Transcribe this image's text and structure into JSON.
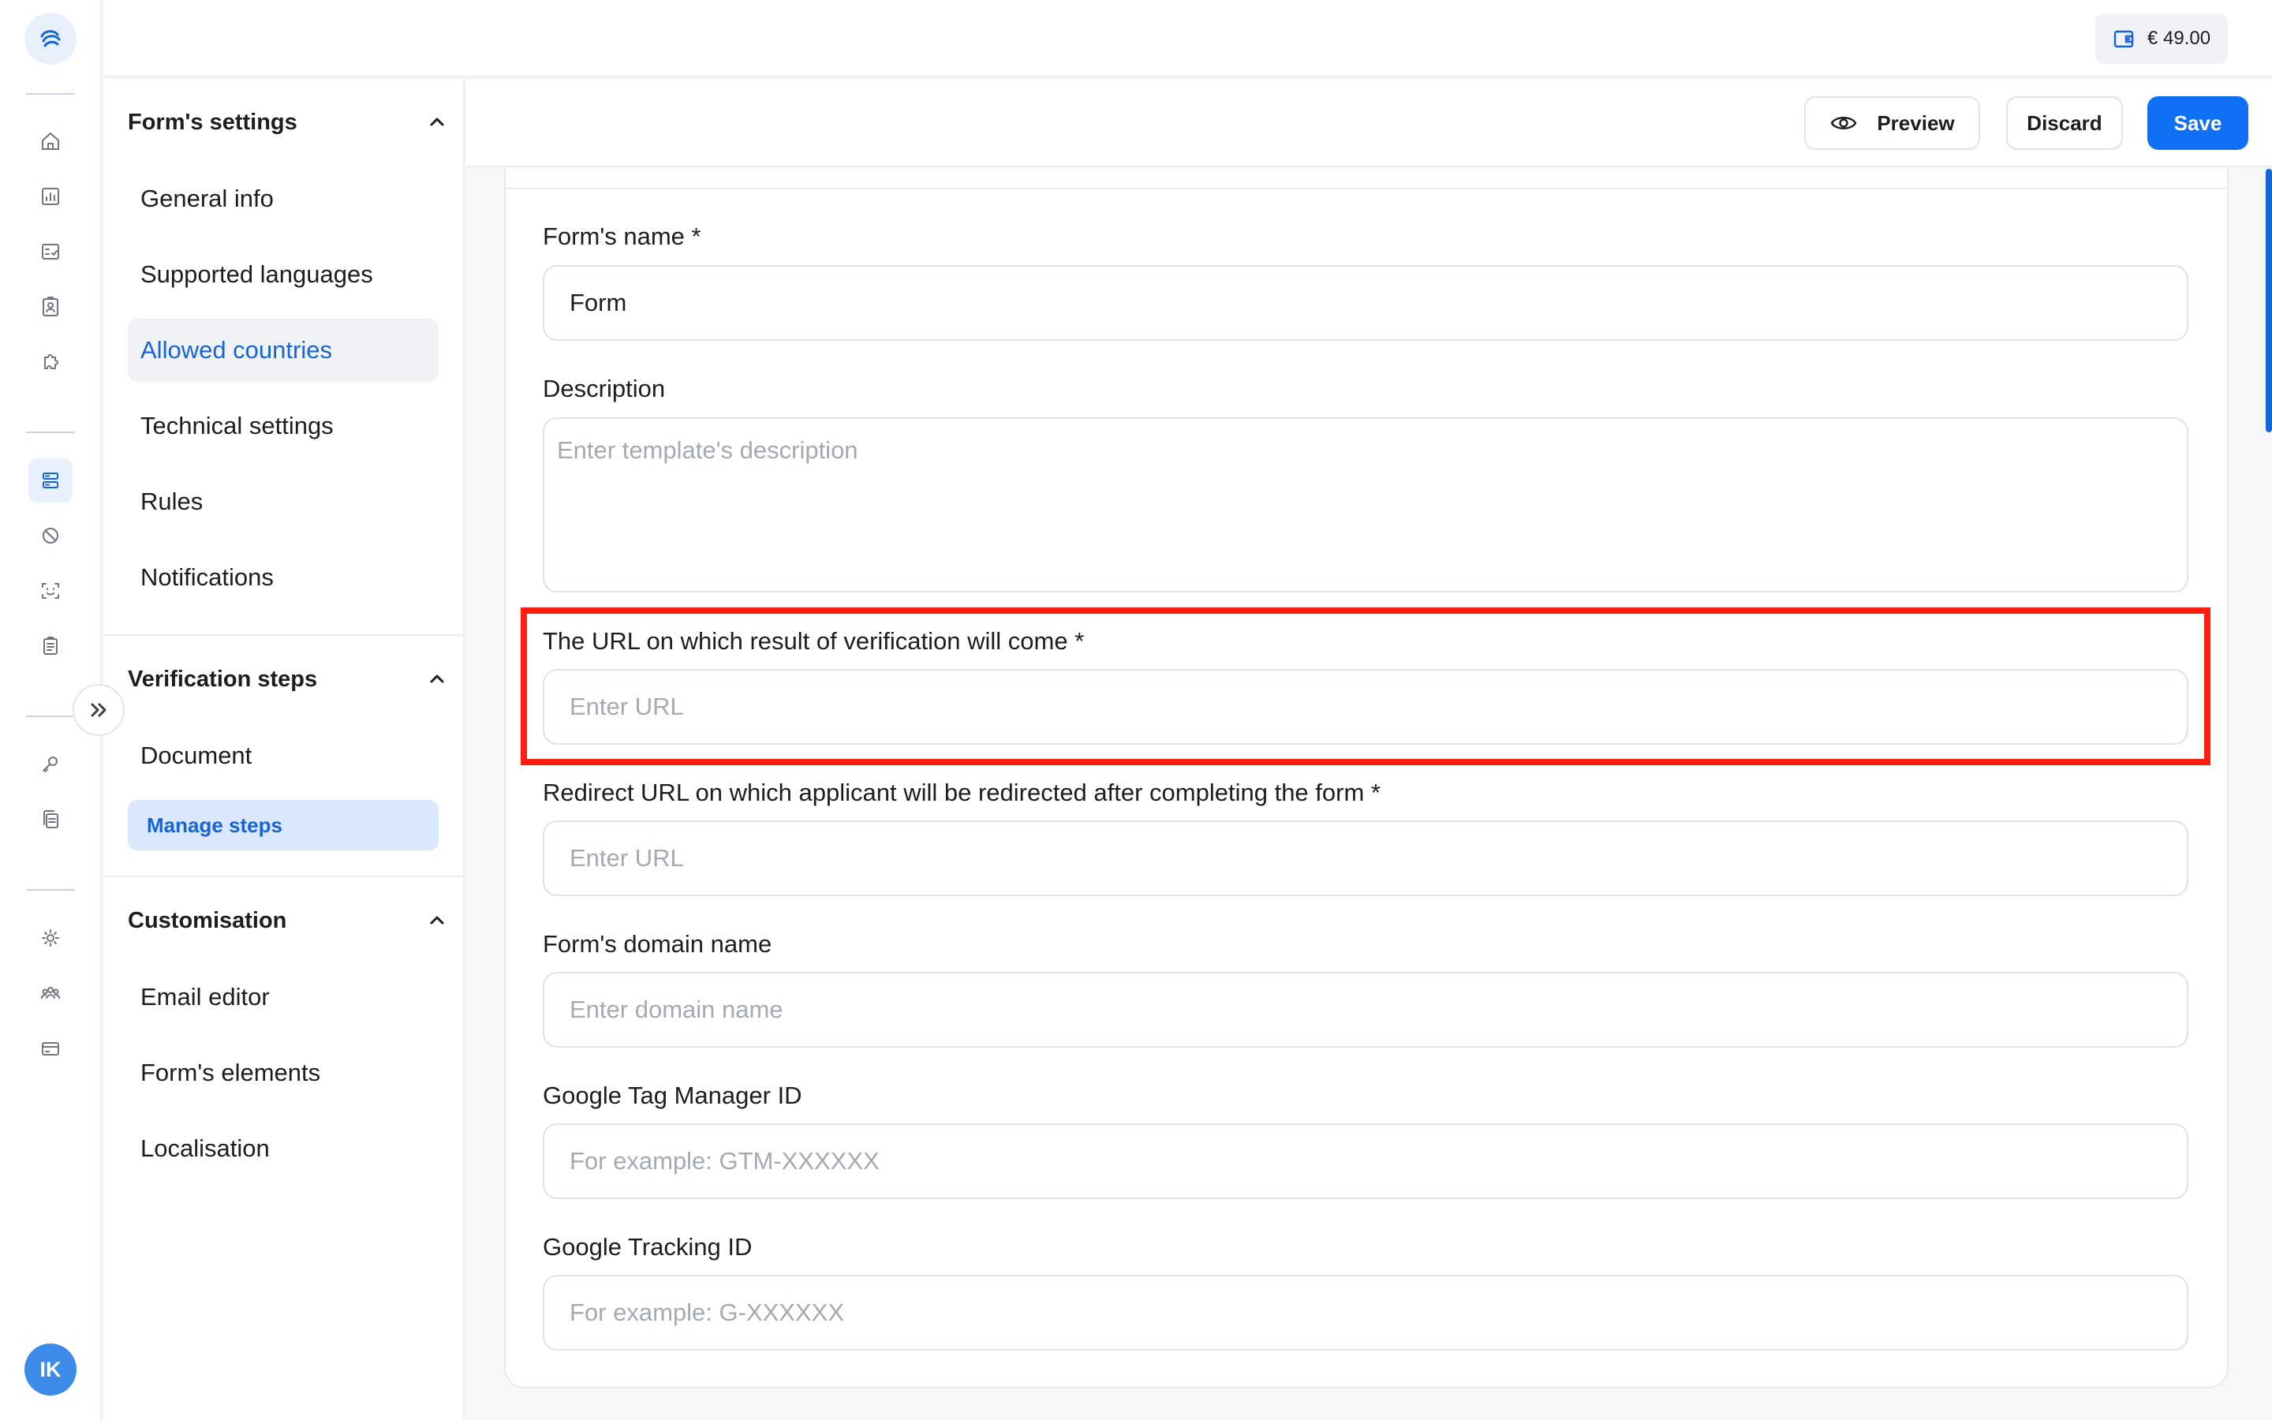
{
  "rail": {
    "logo_icon": "brand-logo-icon",
    "avatar_initials": "IK",
    "items": [
      {
        "icon": "home-icon"
      },
      {
        "icon": "analytics-icon"
      },
      {
        "icon": "checklist-icon"
      },
      {
        "icon": "contact-card-icon"
      },
      {
        "icon": "puzzle-icon"
      },
      {
        "icon": "forms-icon",
        "active": true
      },
      {
        "icon": "blocked-icon"
      },
      {
        "icon": "face-scan-icon"
      },
      {
        "icon": "clipboard-icon"
      },
      {
        "icon": "key-icon"
      },
      {
        "icon": "documents-icon"
      },
      {
        "icon": "settings-icon"
      },
      {
        "icon": "team-icon"
      },
      {
        "icon": "billing-card-icon"
      }
    ]
  },
  "topbar": {
    "balance": "€ 49.00",
    "balance_icon": "wallet-icon"
  },
  "nav": {
    "sections": [
      {
        "title": "Form's settings",
        "items": [
          "General info",
          "Supported languages",
          "Allowed countries",
          "Technical settings",
          "Rules",
          "Notifications"
        ],
        "active_item": "Allowed countries"
      },
      {
        "title": "Verification steps",
        "items": [
          "Document",
          "Manage steps"
        ]
      },
      {
        "title": "Customisation",
        "items": [
          "Email editor",
          "Form's elements",
          "Localisation"
        ]
      }
    ]
  },
  "actions": {
    "preview": "Preview",
    "discard": "Discard",
    "save": "Save"
  },
  "form": {
    "name": {
      "label": "Form's name *",
      "value": "Form"
    },
    "description": {
      "label": "Description",
      "placeholder": "Enter template's description"
    },
    "result_url": {
      "label": "The URL on which result of verification will come *",
      "placeholder": "Enter URL"
    },
    "redirect_url": {
      "label": "Redirect URL on which applicant will be redirected after completing the form *",
      "placeholder": "Enter URL"
    },
    "domain": {
      "label": "Form's domain name",
      "placeholder": "Enter domain name"
    },
    "gtm": {
      "label": "Google Tag Manager ID",
      "placeholder": "For example: GTM-XXXXXX"
    },
    "tracking": {
      "label": "Google Tracking ID",
      "placeholder": "For example: G-XXXXXX"
    }
  },
  "colors": {
    "accent": "#0f6ff5",
    "highlight": "#ff1e10"
  }
}
